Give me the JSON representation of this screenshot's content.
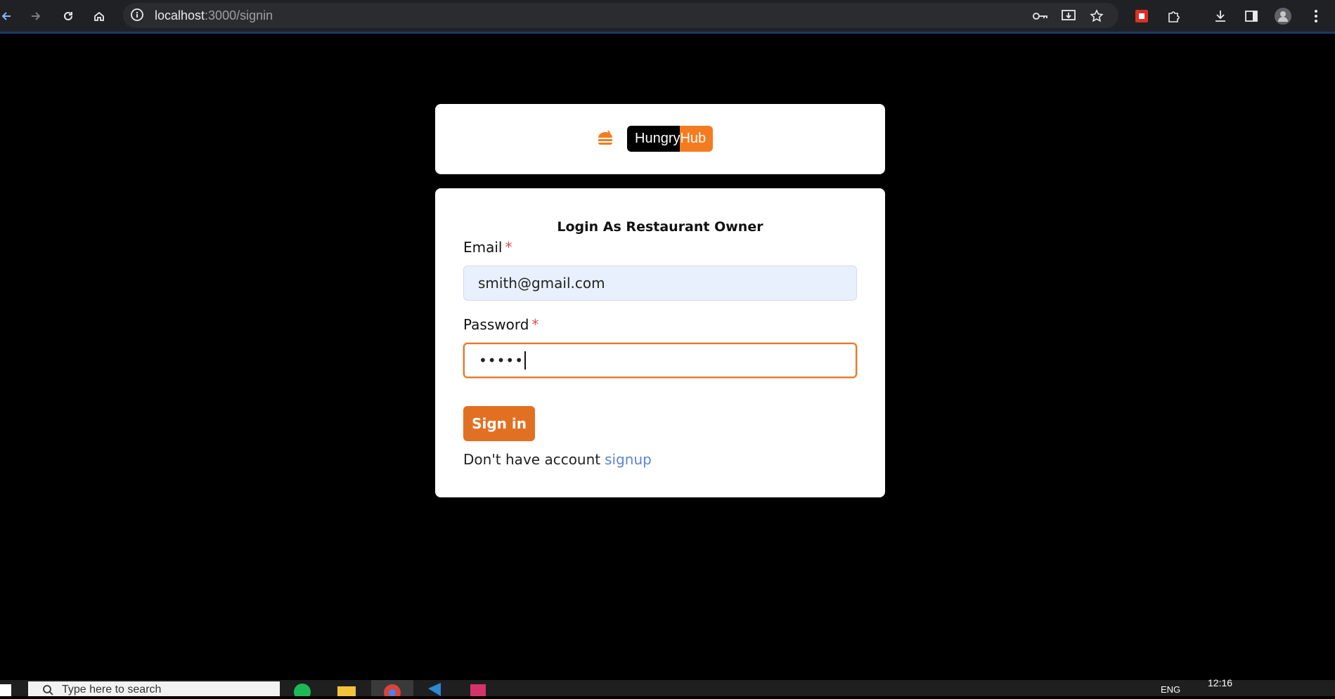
{
  "browser": {
    "url_host": "localhost",
    "url_path": ":3000/signin"
  },
  "logo": {
    "part1": "Hungry",
    "part2": "Hub",
    "accent_color": "#f47c1f"
  },
  "form": {
    "title": "Login As Restaurant Owner",
    "email_label": "Email",
    "email_value": "smith@gmail.com",
    "password_label": "Password",
    "password_value": "•••••",
    "required_marker": "*",
    "submit_label": "Sign in",
    "signup_prompt": "Don't have account",
    "signup_link": "signup"
  },
  "taskbar": {
    "search_text": "Type here to search",
    "lang": "ENG",
    "time": "12:16"
  }
}
